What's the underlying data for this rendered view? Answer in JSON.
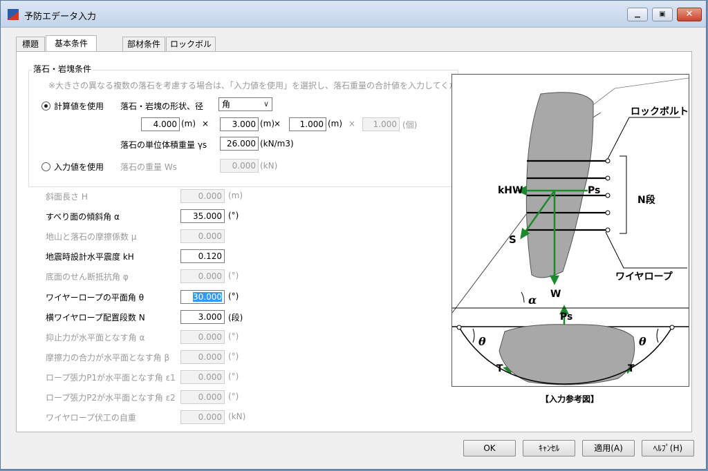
{
  "window": {
    "title": "予防エデータ入力"
  },
  "tabs": [
    "標題",
    "基本条件",
    "部材条件",
    "ロックボルト"
  ],
  "group": {
    "title": "落石・岩塊条件",
    "note": "※大きさの異なる複数の落石を考慮する場合は、「入力値を使用」を選択し、落石重量の合計値を入力してください。",
    "radio_calc": "計算値を使用",
    "radio_input": "入力値を使用",
    "shape_label": "落石・岩塊の形状、径",
    "shape_value": "角",
    "dim1": "4.000",
    "dim2": "3.000",
    "dim3": "1.000",
    "count": "1.000",
    "unit_m": "(m)",
    "times": "×",
    "unit_count": "(個)",
    "unitweight_label": "落石の単位体積重量 γs",
    "unitweight_value": "26.000",
    "unitweight_unit": "(kN/m3)",
    "weight_label": "落石の重量 Ws",
    "weight_value": "0.000",
    "weight_unit": "(kN)"
  },
  "params": [
    {
      "label": "斜面長さ H",
      "value": "0.000",
      "unit": "(m)",
      "enabled": false
    },
    {
      "label": "すべり面の傾斜角 α",
      "value": "35.000",
      "unit": "(°)",
      "enabled": true
    },
    {
      "label": "地山と落石の摩擦係数 μ",
      "value": "0.000",
      "unit": "",
      "enabled": false
    },
    {
      "label": "地震時設計水平震度 kH",
      "value": "0.120",
      "unit": "",
      "enabled": true
    },
    {
      "label": "底面のせん断抵抗角 φ",
      "value": "0.000",
      "unit": "(°)",
      "enabled": false
    },
    {
      "label": "ワイヤーロープの平面角 θ",
      "value": "30.000",
      "unit": "(°)",
      "enabled": true,
      "selected": true
    },
    {
      "label": "横ワイヤロープ配置段数 N",
      "value": "3.000",
      "unit": "(段)",
      "enabled": true
    },
    {
      "label": "抑止力が水平面となす角 α",
      "value": "0.000",
      "unit": "(°)",
      "enabled": false
    },
    {
      "label": "摩擦力の合力が水平面となす角 β",
      "value": "0.000",
      "unit": "(°)",
      "enabled": false
    },
    {
      "label": "ロープ張力P1が水平面となす角 ε1",
      "value": "0.000",
      "unit": "(°)",
      "enabled": false
    },
    {
      "label": "ロープ張力P2が水平面となす角 ε2",
      "value": "0.000",
      "unit": "(°)",
      "enabled": false
    },
    {
      "label": "ワイヤロープ伏工の自重",
      "value": "0.000",
      "unit": "(kN)",
      "enabled": false
    }
  ],
  "figure": {
    "caption": "【入力参考図】",
    "labels": {
      "rockbolt": "ロックボルト",
      "n_dan": "N段",
      "kHW": "kHW",
      "Ps": "Ps",
      "S": "S",
      "W": "W",
      "alpha": "α",
      "wirerope": "ワイヤロープ",
      "Ps2": "Ps",
      "theta": "θ",
      "T": "T"
    }
  },
  "buttons": [
    "OK",
    "ｷｬﾝｾﾙ",
    "適用(A)",
    "ﾍﾙﾌﾟ(H)"
  ]
}
